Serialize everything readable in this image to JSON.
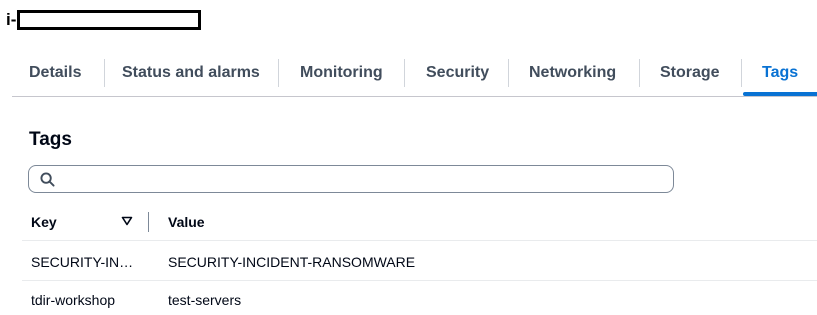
{
  "instance": {
    "id_prefix": "i-"
  },
  "tabs": [
    {
      "label": "Details"
    },
    {
      "label": "Status and alarms"
    },
    {
      "label": "Monitoring"
    },
    {
      "label": "Security"
    },
    {
      "label": "Networking"
    },
    {
      "label": "Storage"
    },
    {
      "label": "Tags",
      "active": true
    }
  ],
  "tags_section": {
    "title": "Tags",
    "search": {
      "value": "",
      "placeholder": "",
      "icon": "search-icon"
    },
    "columns": {
      "key": "Key",
      "value": "Value",
      "sort_icon": "caret-down-icon"
    },
    "rows": [
      {
        "key": "SECURITY-IN…",
        "value": "SECURITY-INCIDENT-RANSOMWARE"
      },
      {
        "key": "tdir-workshop",
        "value": "test-servers"
      }
    ]
  },
  "colors": {
    "accent": "#0972d3",
    "tab_text": "#414d5c",
    "text": "#000716",
    "border": "#7d8998"
  }
}
